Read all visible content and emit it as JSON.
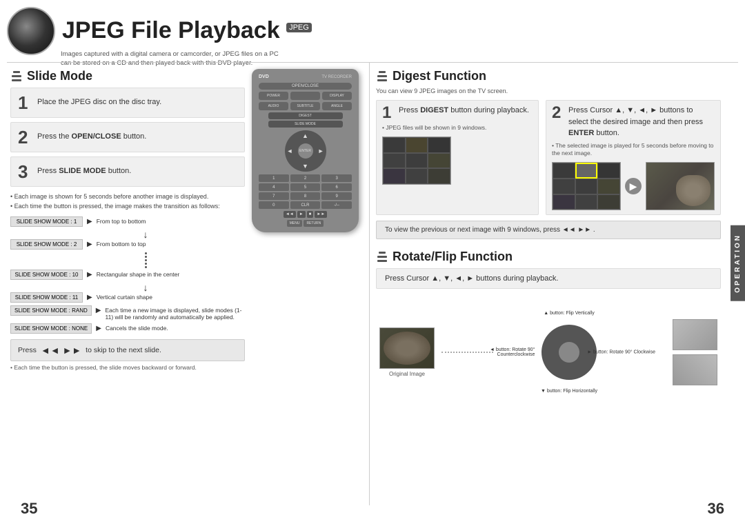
{
  "pages": {
    "left": "35",
    "right": "36"
  },
  "header": {
    "title": "JPEG File Playback",
    "badge": "JPEG",
    "subtitle": "Images captured with a digital camera or camcorder, or JPEG files on a PC can be stored on a CD and then played back with this DVD player."
  },
  "slide_mode": {
    "title": "Slide Mode",
    "steps": [
      {
        "num": "1",
        "text": "Place the JPEG disc on the disc tray."
      },
      {
        "num": "2",
        "text": "Press the ",
        "highlight": "OPEN/CLOSE",
        "text2": " button."
      },
      {
        "num": "3",
        "text": "Press ",
        "highlight": "SLIDE MODE",
        "text2": " button."
      }
    ],
    "notes": [
      "Each image is shown for 5 seconds before another image is displayed.",
      "Each time the button is pressed, the image makes the transition as follows:"
    ],
    "modes": [
      {
        "label": "SLIDE SHOW MODE : 1",
        "desc": "From top to bottom"
      },
      {
        "label": "SLIDE SHOW MODE : 2",
        "desc": "From bottom to top"
      },
      {
        "label": "SLIDE SHOW MODE : 10",
        "desc": "Rectangular shape in the center"
      },
      {
        "label": "SLIDE SHOW MODE : 11",
        "desc": "Vertical curtain shape"
      },
      {
        "label": "SLIDE SHOW MODE : RAND",
        "desc": "Each time a new image is displayed, slide modes (1-11) will be randomly and automatically be applied."
      },
      {
        "label": "SLIDE SHOW MODE : NONE",
        "desc": "Cancels the slide mode."
      }
    ],
    "skip_instruction": "Press      to skip to the next slide.",
    "skip_note": "Each time the button is pressed, the slide moves backward or forward."
  },
  "digest_function": {
    "title": "Digest Function",
    "subtitle": "You can view 9 JPEG images on the TV screen.",
    "step1": {
      "num": "1",
      "text1": "Press ",
      "highlight": "DIGEST",
      "text2": " button during playback.",
      "note": "JPEG files will be shown in 9 windows."
    },
    "step2": {
      "num": "2",
      "text1": "Press Cursor ▲, ▼, ◄, ► buttons to select the desired image and then press ",
      "highlight": "ENTER",
      "text2": " button.",
      "note": "The selected image is played for 5 seconds before moving to the next image."
    },
    "nav_note": "To view the previous or next image with 9 windows, press ◄◄ ►► ."
  },
  "rotate_flip": {
    "title": "Rotate/Flip Function",
    "instruction": "Press Cursor ▲, ▼, ◄, ► buttons during playback.",
    "original_label": "Original Image",
    "labels": {
      "top": "▲ button: Flip Vertically",
      "bottom": "▼ button: Flip Horizontally",
      "left": "◄ button: Rotate 90°\nCounterclockwise",
      "right": "► button: Rotate 90° Clockwise"
    }
  },
  "operation_tab": "OPERATION"
}
